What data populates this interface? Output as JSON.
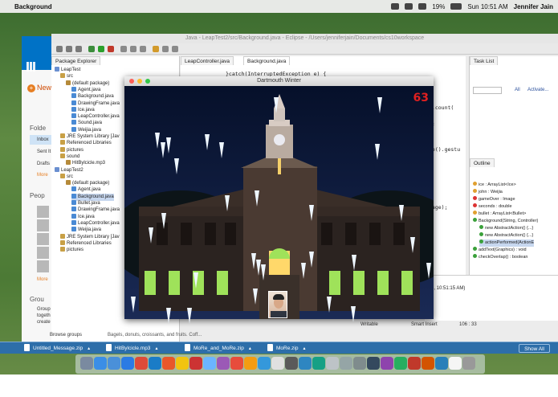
{
  "menubar": {
    "app_name": "Background",
    "battery": "19%",
    "clock": "Sun 10:51 AM",
    "user": "Jennifer Jain"
  },
  "outlook": {
    "new_label": "New",
    "folders_heading": "Folde",
    "folders": [
      "Inbox",
      "Sent It",
      "Drafts"
    ],
    "more": "More",
    "people_heading": "Peop",
    "people_more": "More",
    "groups_heading": "Grou",
    "groups_text": [
      "Group",
      "togeth",
      "create"
    ],
    "browse_groups": "Browse groups",
    "preview_snippet": "Bagels, donuts, croissants, and fruits. Coff..."
  },
  "eclipse": {
    "title": "Java - LeapTest2/src/Background.java - Eclipse - /Users/jenniferjain/Documents/cs10workspace",
    "package_explorer_tab": "Package Explorer",
    "editor_tabs": [
      "LeapController.java",
      "Background.java"
    ],
    "tree": [
      {
        "label": "LeapTest",
        "indent": 0
      },
      {
        "label": "src",
        "indent": 1
      },
      {
        "label": "(default package)",
        "indent": 2
      },
      {
        "label": "Agent.java",
        "indent": 3
      },
      {
        "label": "Background.java",
        "indent": 3
      },
      {
        "label": "DrawingFrame.java",
        "indent": 3
      },
      {
        "label": "Ice.java",
        "indent": 3
      },
      {
        "label": "LeapController.java",
        "indent": 3
      },
      {
        "label": "Sound.java",
        "indent": 3
      },
      {
        "label": "Weijia.java",
        "indent": 3
      },
      {
        "label": "JRE System Library [Jav",
        "indent": 1
      },
      {
        "label": "Referenced Libraries",
        "indent": 1
      },
      {
        "label": "pictures",
        "indent": 1
      },
      {
        "label": "sound",
        "indent": 1
      },
      {
        "label": "HitBylcicle.mp3",
        "indent": 2
      },
      {
        "label": "LeapTest2",
        "indent": 0
      },
      {
        "label": "src",
        "indent": 1
      },
      {
        "label": "(default package)",
        "indent": 2
      },
      {
        "label": "Agent.java",
        "indent": 3
      },
      {
        "label": "Background.java",
        "indent": 3
      },
      {
        "label": "Bullet.java",
        "indent": 3
      },
      {
        "label": "DrawingFrame.java",
        "indent": 3
      },
      {
        "label": "Ice.java",
        "indent": 3
      },
      {
        "label": "LeapController.java",
        "indent": 3
      },
      {
        "label": "Weijia.java",
        "indent": 3
      },
      {
        "label": "JRE System Library [Jav",
        "indent": 1
      },
      {
        "label": "Referenced Libraries",
        "indent": 1
      },
      {
        "label": "pictures",
        "indent": 1
      }
    ],
    "code_lines": [
      "}catch(InterruptedException e) {"
    ],
    "right_code": [
      ").count(",
      "0;",
      "me().gestu",
      "mage);"
    ],
    "task_list_tab": "Task List",
    "task_filter": "All",
    "task_activate": "Activate...",
    "outline_tab": "Outline",
    "outline_rows": [
      "ice : ArrayList<Ice>",
      "john : Weijia",
      "gameOver : Image",
      "seconds : double",
      "bullet : ArrayList<Bullet>",
      "Background(String, Controller)",
      "new AbstractAction() {...}",
      "new AbstractAction() {...}",
      "actionPerformed(ActionE",
      "addText(Graphics) : void",
      "checkOverlap() : boolean"
    ],
    "console_time": "5, 10:51:15 AM)",
    "status_writable": "Writable",
    "status_insert": "Smart Insert",
    "status_position": "106 : 33"
  },
  "game": {
    "title": "Dartmouth Winter",
    "score": "63"
  },
  "downloads": {
    "items": [
      "Untitled_Message.zip",
      "HitBylcicle.mp3",
      "MoRe_and_MoRe.zip",
      "MoRe.zip"
    ],
    "show_all": "Show All"
  },
  "colors": {
    "accent_blue": "#2d6ea9",
    "score_red": "#e02020",
    "outlook_orange": "#e67e22"
  }
}
